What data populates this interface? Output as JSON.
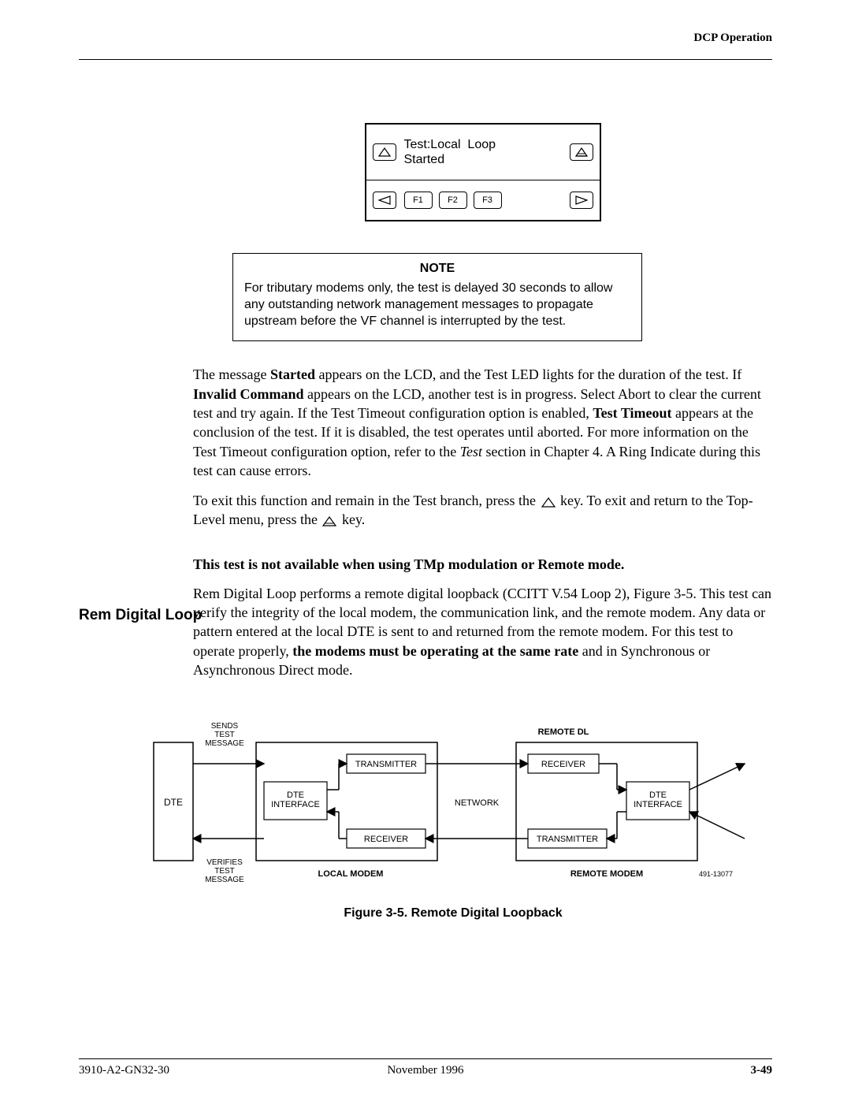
{
  "header": {
    "section": "DCP Operation"
  },
  "lcd": {
    "line1": "Test:Local  Loop",
    "line2": "Started",
    "f1": "F1",
    "f2": "F2",
    "f3": "F3"
  },
  "note": {
    "title": "NOTE",
    "body": "For tributary modems only, the test is delayed 30 seconds to allow any outstanding network management messages to propagate upstream before the VF channel is interrupted by the test."
  },
  "para1_a": "The message ",
  "para1_b": "Started",
  "para1_c": " appears on the LCD, and the Test LED lights for the duration of the test. If ",
  "para1_d": "Invalid Command",
  "para1_e": " appears on the LCD, another test is in progress. Select Abort to clear the current test and try again. If the Test Timeout configuration option is enabled, ",
  "para1_f": "Test Timeout",
  "para1_g": " appears at the conclusion of the test. If it is disabled, the test operates until aborted. For more information on the Test Timeout configuration option, refer to the ",
  "para1_h": "Test",
  "para1_i": " section in Chapter 4. A Ring Indicate during this test can cause errors.",
  "para2_a": "To exit this function and remain in the Test branch, press the ",
  "para2_b": " key. To exit and return to the Top-Level menu, press the ",
  "para2_c": " key.",
  "heading": "Rem Digital Loop",
  "bold_line": "This test is not available when using TMp modulation or Remote mode.",
  "para3_a": "Rem Digital Loop performs a remote digital loopback (CCITT V.54 Loop 2), Figure 3-5. This test can verify the integrity of the local modem, the communication link, and the remote modem. Any data or pattern entered at the local DTE is sent to and returned from the remote modem. For this test to operate properly, ",
  "para3_b": "the modems must be operating at the same rate",
  "para3_c": " and in Synchronous or Asynchronous Direct mode.",
  "diagram": {
    "dte": "DTE",
    "sends": "SENDS\nTEST\nMESSAGE",
    "verifies": "VERIFIES\nTEST\nMESSAGE",
    "dte_interface": "DTE\nINTERFACE",
    "transmitter": "TRANSMITTER",
    "receiver": "RECEIVER",
    "network": "NETWORK",
    "remote_dl": "REMOTE DL",
    "local_modem": "LOCAL MODEM",
    "remote_modem": "REMOTE MODEM",
    "fignum": "491-13077"
  },
  "figure_caption": "Figure 3-5.  Remote Digital Loopback",
  "footer": {
    "left": "3910-A2-GN32-30",
    "center": "November 1996",
    "right": "3-49"
  }
}
